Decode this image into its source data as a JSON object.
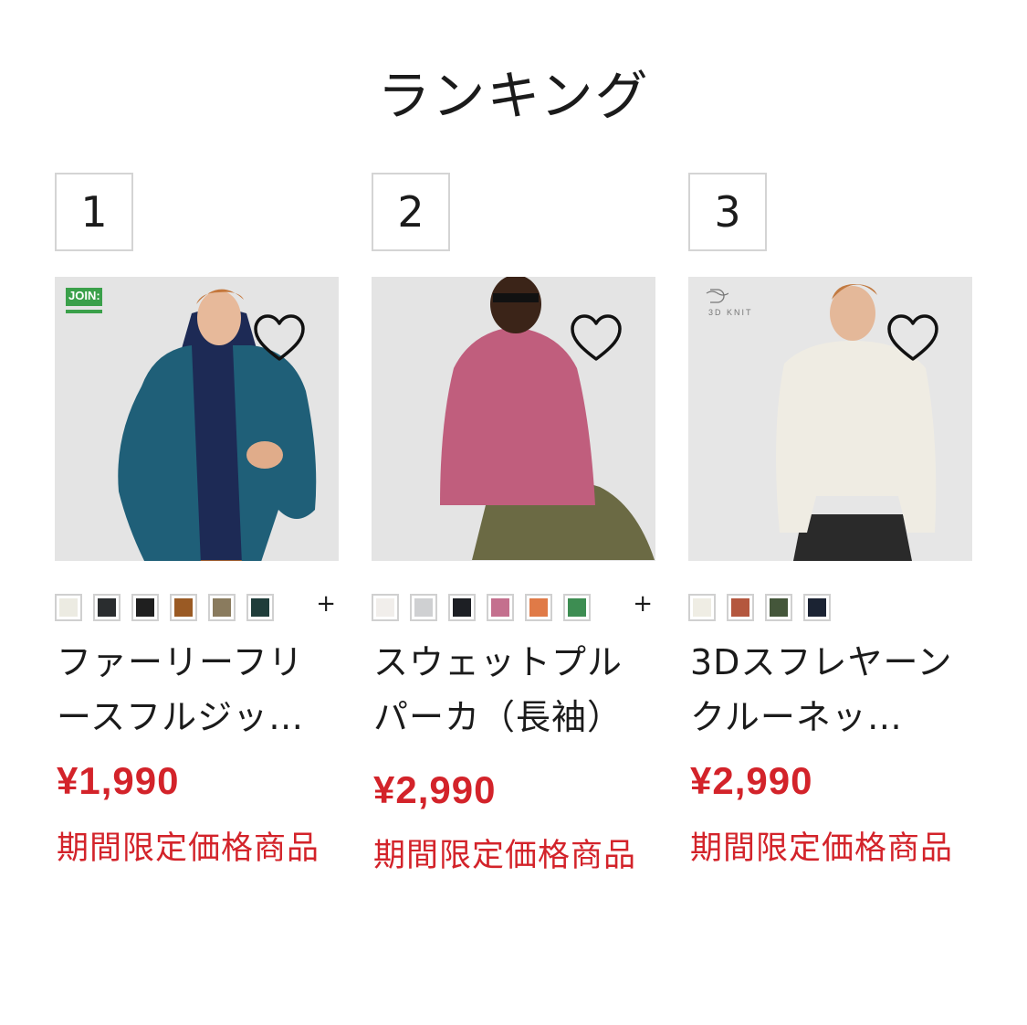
{
  "section_title": "ランキング",
  "products": [
    {
      "rank": "1",
      "badge": "JOIN:",
      "name": "ファーリーフリースフルジッ…",
      "price": "¥1,990",
      "note": "期間限定価格商品",
      "more_colors": "+",
      "swatches": [
        "#ecebe2",
        "#2a2d2f",
        "#1f1f1f",
        "#9a5a24",
        "#8a7b5e",
        "#1f3d3a"
      ],
      "icons": [
        "favorite-heart-icon"
      ]
    },
    {
      "rank": "2",
      "badge": "",
      "name": "スウェットプルパーカ（長袖）",
      "price": "¥2,990",
      "note": "期間限定価格商品",
      "more_colors": "+",
      "swatches": [
        "#f1eeeb",
        "#cfd0d2",
        "#1d1f24",
        "#c4708e",
        "#e07a47",
        "#3d8d52"
      ],
      "icons": [
        "favorite-heart-icon"
      ]
    },
    {
      "rank": "3",
      "badge": "3D KNIT",
      "name": "3Dスフレヤーンクルーネッ…",
      "price": "¥2,990",
      "note": "期間限定価格商品",
      "more_colors": "",
      "swatches": [
        "#efede4",
        "#b4573e",
        "#44563a",
        "#1b2333"
      ],
      "icons": [
        "favorite-heart-icon"
      ]
    }
  ],
  "colors": {
    "accent": "#d3232a",
    "text": "#1b1b1b",
    "border": "#d4d4d4"
  }
}
